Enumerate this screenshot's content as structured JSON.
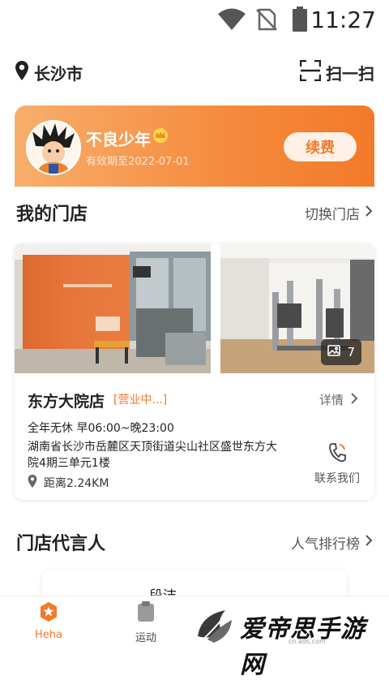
{
  "status_bar": {
    "time": "11:27"
  },
  "header": {
    "city": "长沙市",
    "scan_label": "扫一扫"
  },
  "member": {
    "name": "不良少年",
    "expiry": "有效期至2022-07-01",
    "renew_label": "续费"
  },
  "my_store": {
    "title": "我的门店",
    "switch_label": "切换门店"
  },
  "store": {
    "photo_count": "7",
    "name": "东方大院店",
    "status": "[营业中...]",
    "detail_label": "详情",
    "hours": "全年无休 早06:00~晚23:00",
    "address": "湖南省长沙市岳麓区天顶街道尖山社区盛世东方大院4期三单元1楼",
    "distance": "距离2.24KM",
    "contact_label": "联系我们"
  },
  "endorser": {
    "title": "门店代言人",
    "ranking_label": "人气排行榜",
    "first_name": "段洁"
  },
  "bottom_nav": {
    "items": [
      {
        "label": "Heha"
      },
      {
        "label": "运动"
      }
    ]
  },
  "watermark": {
    "text": "爱帝思手游网",
    "sub": "cn.ads.com"
  },
  "colors": {
    "accent": "#f27a2a",
    "card_gradient_start": "#f8ae6c",
    "card_gradient_end": "#f27a2a"
  }
}
